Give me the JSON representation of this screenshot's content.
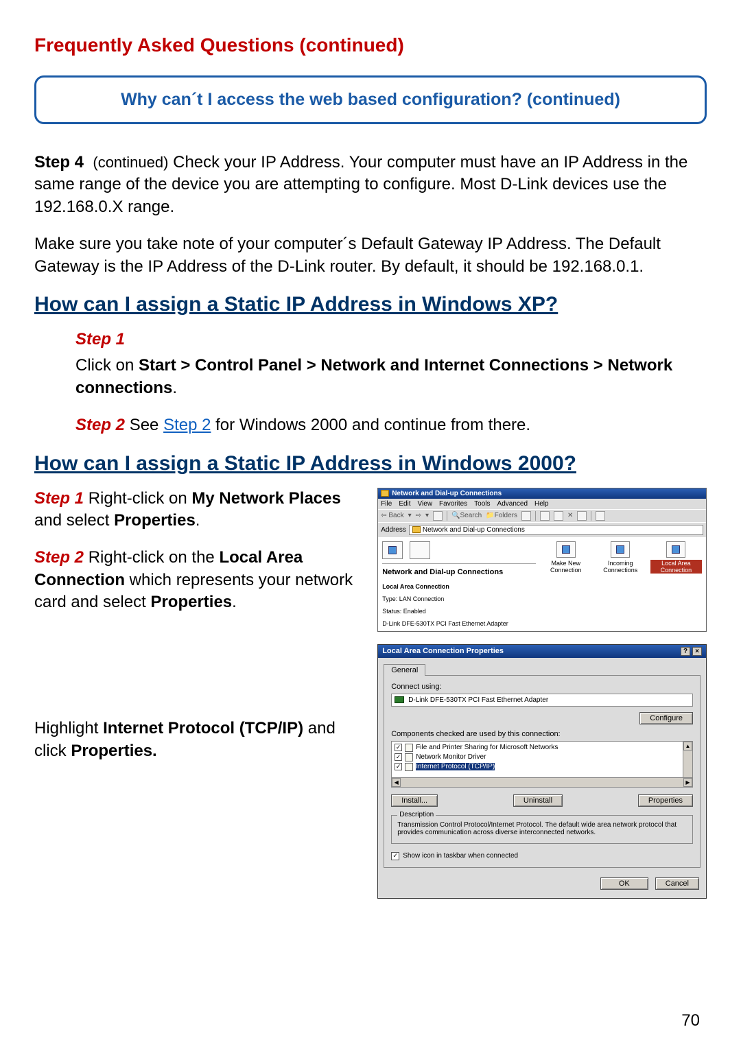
{
  "page": {
    "title": "Frequently Asked Questions (continued)",
    "number": "70"
  },
  "callout": {
    "text": "Why can´t I access the web based configuration? (continued)"
  },
  "step4": {
    "label": "Step 4",
    "cont": "(continued)",
    "text_a": "Check your IP Address. Your computer must have an IP Address in the same range of the device you are attempting to configure. Most D-Link devices use the 192.168.0.X range.",
    "text_b": "Make sure you take note of your computer´s Default Gateway IP Address. The Default Gateway is the IP Address of the D-Link router. By default, it should be 192.168.0.1."
  },
  "xp": {
    "heading": "How can I assign a Static IP Address in Windows XP?",
    "step1_label": "Step 1",
    "step1_pre": "Click on ",
    "step1_bold": "Start > Control Panel > Network and Internet Connections > Network connections",
    "step1_post": ".",
    "step2_label": "Step 2",
    "step2_pre": " See ",
    "step2_link": "Step 2",
    "step2_post": " for Windows 2000 and continue from there."
  },
  "w2k": {
    "heading": "How can I assign a Static IP Address in Windows 2000?",
    "s1_label": "Step 1",
    "s1_a": " Right-click on ",
    "s1_b": "My Network Places",
    "s1_c": " and select ",
    "s1_d": "Properties",
    "s1_e": ".",
    "s2_label": "Step 2",
    "s2_a": " Right-click on the ",
    "s2_b": "Local Area Connection",
    "s2_c": " which represents your network card and select ",
    "s2_d": "Properties",
    "s2_e": ".",
    "s3_a": "Highlight ",
    "s3_b": "Internet Protocol (TCP/IP)",
    "s3_c": " and click ",
    "s3_d": "Properties.",
    "s3_e": ""
  },
  "shot1": {
    "title": "Network and Dial-up Connections",
    "menu": [
      "File",
      "Edit",
      "View",
      "Favorites",
      "Tools",
      "Advanced",
      "Help"
    ],
    "back": "Back",
    "toolbar": {
      "search": "Search",
      "folders": "Folders"
    },
    "addr_label": "Address",
    "addr_value": "Network and Dial-up Connections",
    "left_header": "Network and Dial-up Connections",
    "lac_hdr": "Local Area Connection",
    "lac_type": "Type: LAN Connection",
    "lac_status": "Status: Enabled",
    "lac_device": "D-Link DFE-530TX PCI Fast Ethernet Adapter",
    "icons": [
      {
        "label": "Make New Connection"
      },
      {
        "label": "Incoming Connections"
      },
      {
        "label": "Local Area Connection"
      }
    ]
  },
  "shot2": {
    "title": "Local Area Connection Properties",
    "tab": "General",
    "connect_using": "Connect using:",
    "adapter": "D-Link DFE-530TX PCI Fast Ethernet Adapter",
    "configure": "Configure",
    "components_lbl": "Components checked are used by this connection:",
    "components": [
      "File and Printer Sharing for Microsoft Networks",
      "Network Monitor Driver",
      "Internet Protocol (TCP/IP)"
    ],
    "install": "Install...",
    "uninstall": "Uninstall",
    "properties": "Properties",
    "desc_legend": "Description",
    "desc_text": "Transmission Control Protocol/Internet Protocol. The default wide area network protocol that provides communication across diverse interconnected networks.",
    "show_icon": "Show icon in taskbar when connected",
    "ok": "OK",
    "cancel": "Cancel"
  }
}
